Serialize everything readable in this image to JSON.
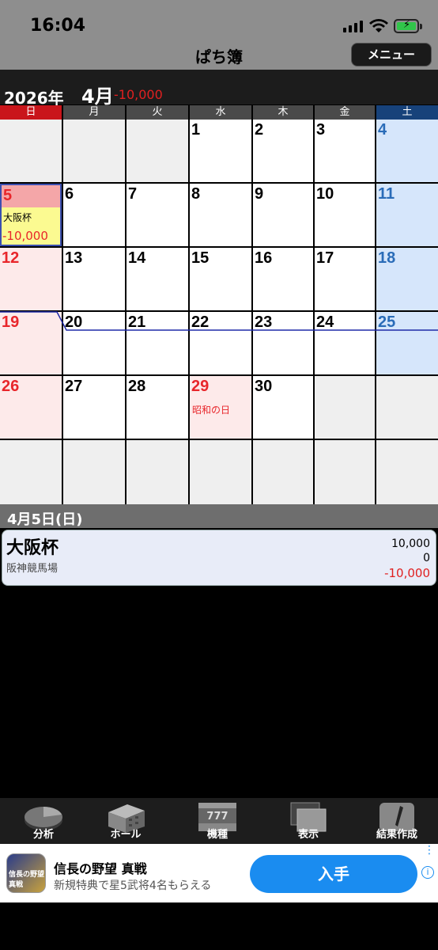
{
  "status": {
    "time": "16:04"
  },
  "nav": {
    "title": "ぱち簿",
    "menu_label": "メニュー"
  },
  "month_header": {
    "year": "2026年",
    "month": "4月",
    "total": "-10,000"
  },
  "weekdays": [
    "日",
    "月",
    "火",
    "水",
    "木",
    "金",
    "土"
  ],
  "calendar": {
    "day_labels": [
      "1",
      "2",
      "3",
      "4",
      "5",
      "6",
      "7",
      "8",
      "9",
      "10",
      "11",
      "12",
      "13",
      "14",
      "15",
      "16",
      "17",
      "18",
      "19",
      "20",
      "21",
      "22",
      "23",
      "24",
      "25",
      "26",
      "27",
      "28",
      "29",
      "30"
    ],
    "holiday_29": "昭和の日",
    "event_5": {
      "name": "大阪杯",
      "amount": "-10,000"
    }
  },
  "detail": {
    "date": "4月5日(日)",
    "event_name": "大阪杯",
    "venue": "阪神競馬場",
    "amount_in": "10,000",
    "amount_out": "0",
    "balance": "-10,000"
  },
  "tabs": {
    "analysis": "分析",
    "hall": "ホール",
    "machine": "機種",
    "display": "表示",
    "report": "結果作成"
  },
  "ad": {
    "title": "信長の野望 真戦",
    "subtitle": "新規特典で星5武将4名もらえる",
    "cta": "入手",
    "thumb_text": "信長の野望 真戦"
  },
  "colors": {
    "sunday_header": "#c9151b",
    "saturday_header": "#17427a",
    "weekday_header": "#4a4a4a",
    "sunday_text": "#e8262b",
    "saturday_text": "#2a6cb8",
    "negative": "#e02020"
  }
}
